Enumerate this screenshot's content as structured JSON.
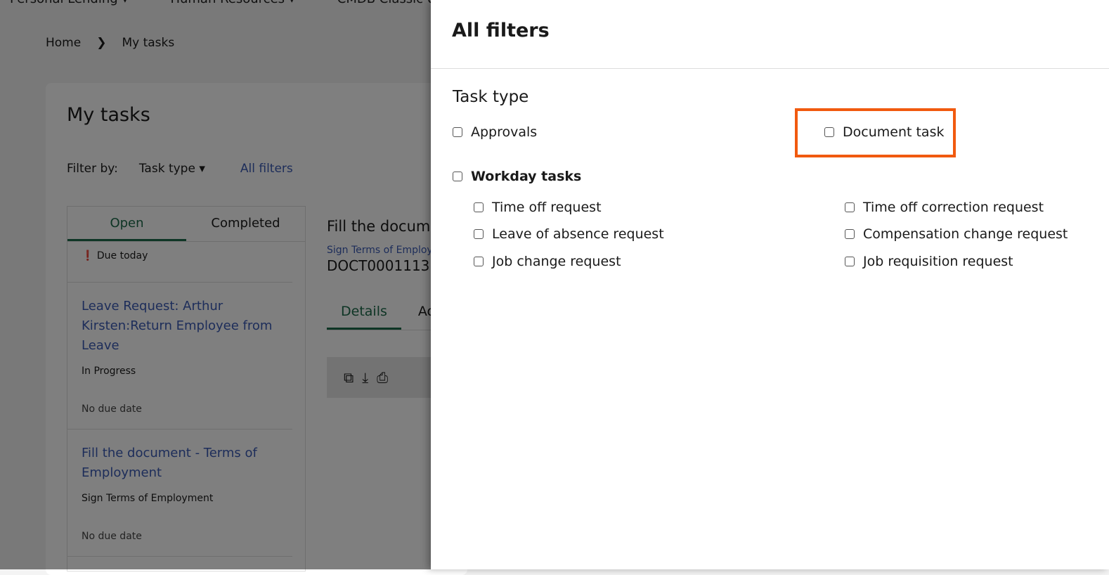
{
  "topnav": [
    "Personal Lending ▾",
    "Human Resources ▾",
    "CMDB Classic UI"
  ],
  "breadcrumb": {
    "home": "Home",
    "sep": "❯",
    "current": "My tasks"
  },
  "page_title": "My tasks",
  "filter": {
    "label": "Filter by:",
    "task_type": "Task type ▾",
    "all_filters": "All filters"
  },
  "list": {
    "tabs": [
      "Open",
      "Completed"
    ],
    "due": "❗ Due today",
    "items": [
      {
        "title": "Leave Request: Arthur Kirsten:Return Employee from Leave",
        "status": "In Progress",
        "due": "No due date"
      },
      {
        "title": "Fill the document - Terms of Employment",
        "status": "Sign Terms of Employment",
        "due": "No due date"
      }
    ]
  },
  "detail": {
    "title": "Fill the docume",
    "subtitle": "Sign Terms of Employm",
    "number": "DOCT0001113",
    "tabs": [
      "Details",
      "Ac"
    ]
  },
  "panel": {
    "title": "All filters",
    "section": "Task type",
    "approvals": "Approvals",
    "document_task": "Document task",
    "workday": "Workday tasks",
    "workday_items": [
      "Time off request",
      "Time off correction request",
      "Leave of absence request",
      "Compensation change request",
      "Job change request",
      "Job requisition request"
    ]
  },
  "colors": {
    "highlight": "#f15a0f",
    "accent": "#1c6b4a",
    "link": "#3b5bb5"
  }
}
